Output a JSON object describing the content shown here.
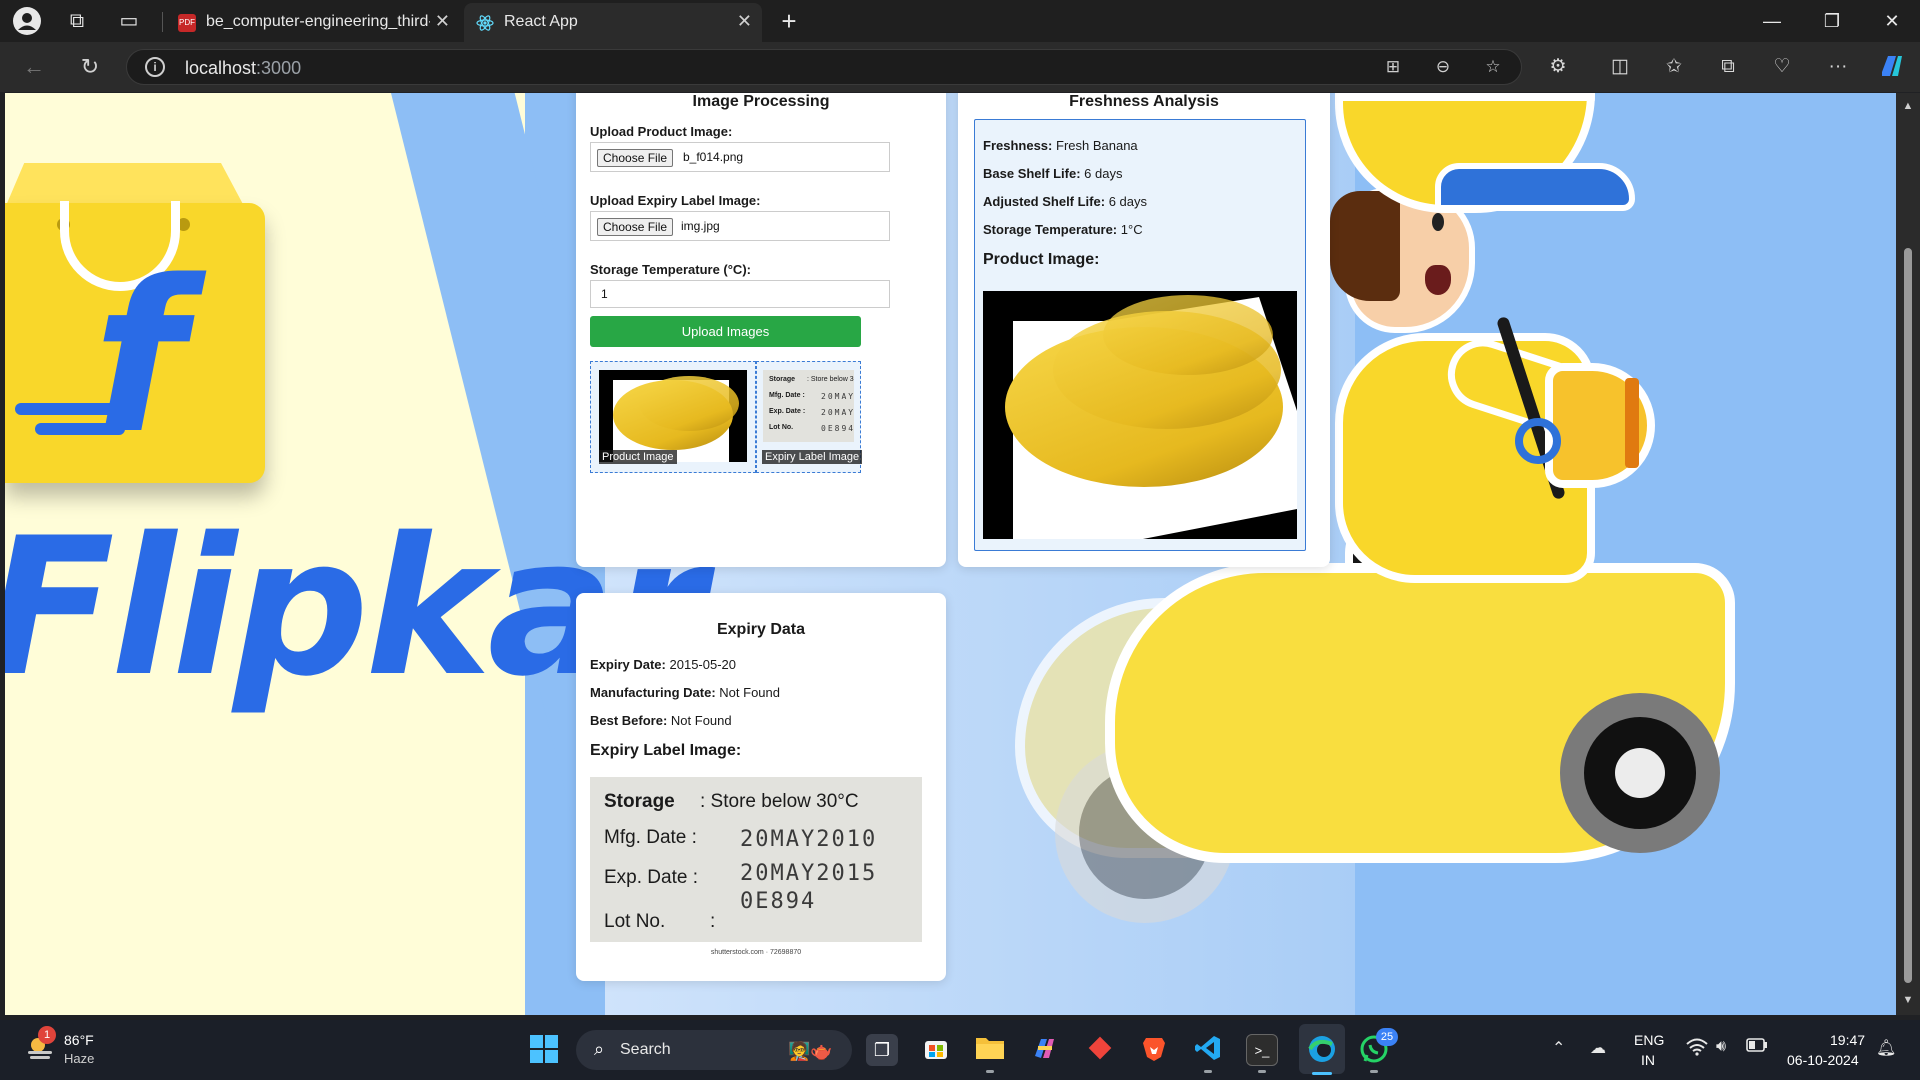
{
  "browser": {
    "tabs": [
      {
        "label": "be_computer-engineering_third-y",
        "active": false,
        "favicon": "pdf-icon"
      },
      {
        "label": "React App",
        "active": true,
        "favicon": "react-icon"
      }
    ],
    "url_host": "localhost",
    "url_port": ":3000"
  },
  "app": {
    "image_processing": {
      "title": "Image Processing",
      "product_label": "Upload Product Image:",
      "product_button": "Choose File",
      "product_file": "b_f014.png",
      "expiry_label": "Upload Expiry Label Image:",
      "expiry_button": "Choose File",
      "expiry_file": "img.jpg",
      "temperature_label": "Storage Temperature (°C):",
      "temperature_value": "1",
      "upload_button": "Upload Images",
      "preview_product_caption": "Product Image",
      "preview_expiry_caption": "Expiry Label Image"
    },
    "freshness": {
      "title": "Freshness Analysis",
      "freshness_key": "Freshness:",
      "freshness_value": "Fresh Banana",
      "base_key": "Base Shelf Life:",
      "base_value": "6 days",
      "adjusted_key": "Adjusted Shelf Life:",
      "adjusted_value": "6 days",
      "temp_key": "Storage Temperature:",
      "temp_value": "1°C",
      "product_image_heading": "Product Image:"
    },
    "expiry": {
      "title": "Expiry Data",
      "expiry_key": "Expiry Date:",
      "expiry_value": "2015-05-20",
      "mfg_key": "Manufacturing Date:",
      "mfg_value": "Not Found",
      "best_key": "Best Before:",
      "best_value": "Not Found",
      "label_image_heading": "Expiry Label Image:"
    },
    "expiry_label_image": {
      "storage_key": "Storage",
      "storage_value": ": Store below 30°C",
      "mfg_key": "Mfg. Date :",
      "mfg_value": "20MAY2010",
      "exp_key": "Exp. Date :",
      "exp_value": "20MAY2015",
      "lot_key": "Lot No.",
      "lot_sep": ":",
      "lot_value": "0E894",
      "credit": "shutterstock.com · 72698870"
    }
  },
  "background": {
    "brand_text": "Flipkar",
    "brand_letter": "f"
  },
  "taskbar": {
    "weather_temp": "86°F",
    "weather_desc": "Haze",
    "weather_badge": "1",
    "search_placeholder": "Search",
    "whatsapp_badge": "25",
    "lang_line1": "ENG",
    "lang_line2": "IN",
    "time": "19:47",
    "date": "06-10-2024"
  },
  "colors": {
    "accent_green": "#28a745",
    "brand_blue": "#2a6be6",
    "brand_yellow": "#f9d72a"
  }
}
